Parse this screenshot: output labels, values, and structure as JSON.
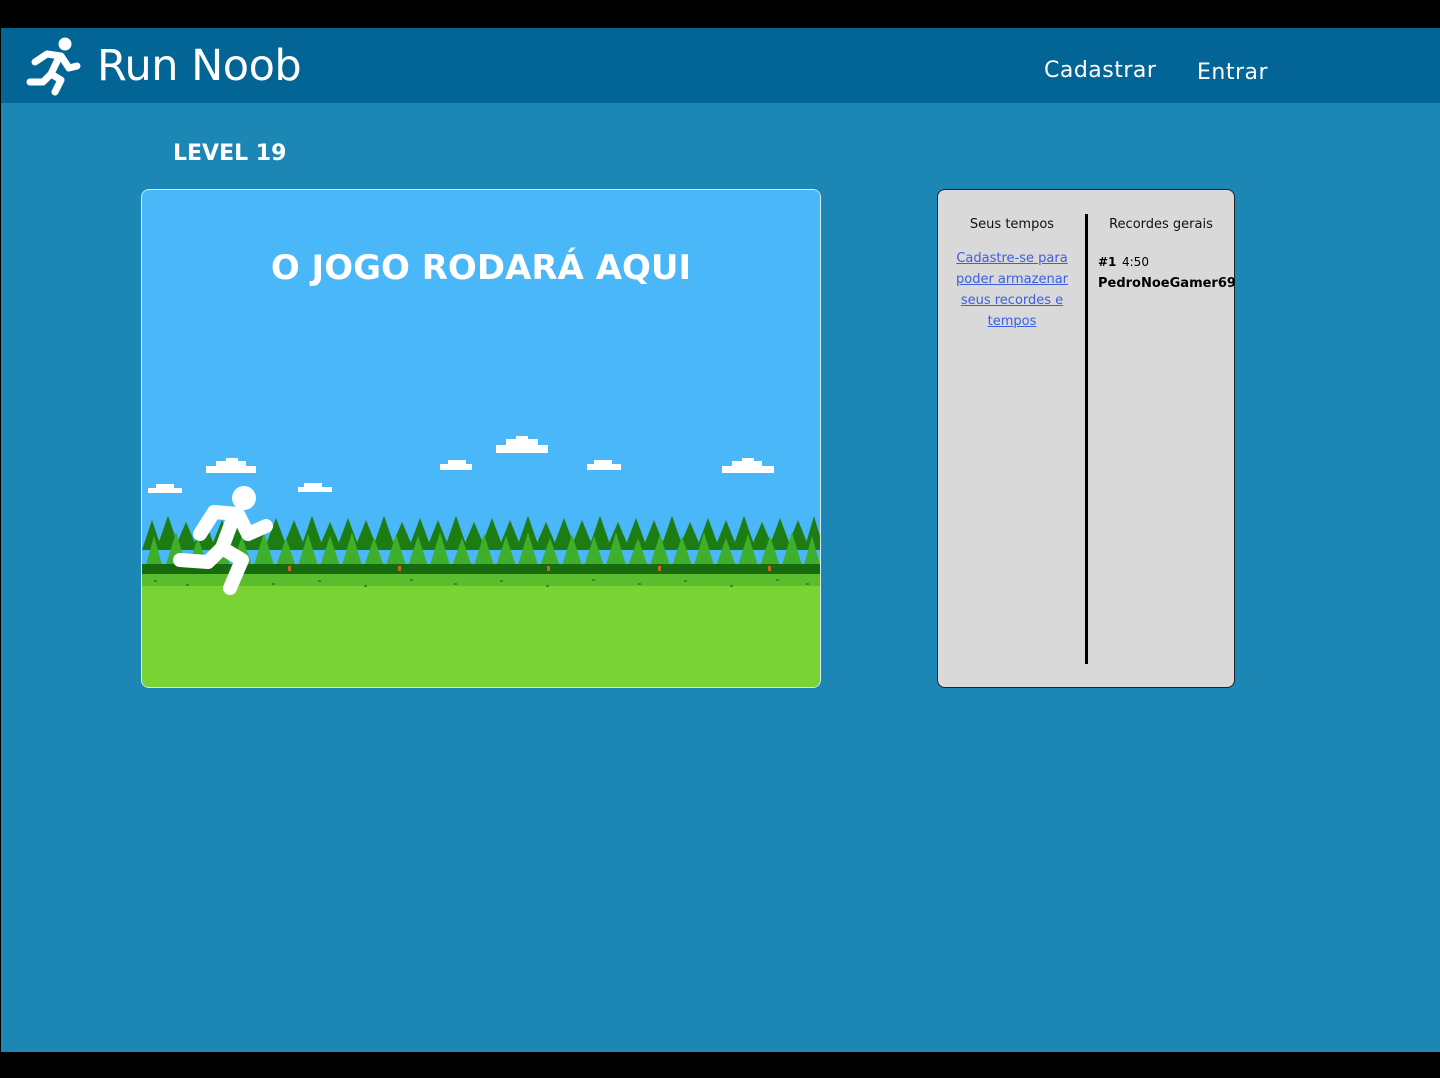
{
  "header": {
    "brand": "Run Noob",
    "nav": {
      "register": "Cadastrar",
      "login": "Entrar"
    }
  },
  "level": "LEVEL 19",
  "game": {
    "placeholder": "O JOGO RODARÁ AQUI"
  },
  "records": {
    "your_times": {
      "title": "Seus tempos",
      "signup_prompt": "Cadastre-se para poder armazenar seus recordes e tempos"
    },
    "global": {
      "title": "Recordes gerais",
      "entries": [
        {
          "rank": "#1",
          "time": "4:50",
          "player": "PedroNoeGamer69"
        }
      ]
    }
  },
  "colors": {
    "page_background": "#1c87b5",
    "header_background": "#036595",
    "sky": "#4ab7f8",
    "grass": "#79d335",
    "panel": "#d9d9d9",
    "link": "#3a5fe0"
  },
  "icons": {
    "logo": "running-person-icon",
    "runner": "running-person-icon"
  }
}
